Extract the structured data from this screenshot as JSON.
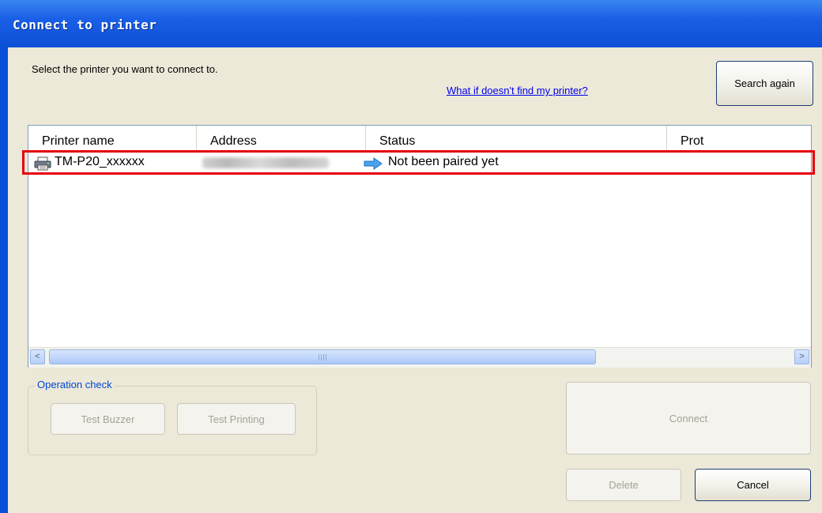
{
  "window": {
    "title": "Connect to printer"
  },
  "instruction": "Select the printer you want to connect to.",
  "help_link": "What if doesn't find my printer?",
  "search_button": "Search again",
  "table": {
    "columns": [
      "Printer name",
      "Address",
      "Status",
      "Prot"
    ],
    "rows": [
      {
        "printer_name": "TM-P20_xxxxxx",
        "printer_icon": "printer-icon",
        "status_icon": "right-arrow-icon",
        "status": "Not been paired yet"
      }
    ]
  },
  "scrollbar": {
    "left_arrow": "<",
    "right_arrow": ">"
  },
  "operation_check": {
    "label": "Operation check",
    "test_buzzer": "Test Buzzer",
    "test_printing": "Test Printing"
  },
  "buttons": {
    "connect": "Connect",
    "delete": "Delete",
    "cancel": "Cancel"
  },
  "colors": {
    "title_bar": "#0b4fd6",
    "client_bg": "#ece9d8",
    "highlight": "#e5000b",
    "link": "#0000ee"
  }
}
